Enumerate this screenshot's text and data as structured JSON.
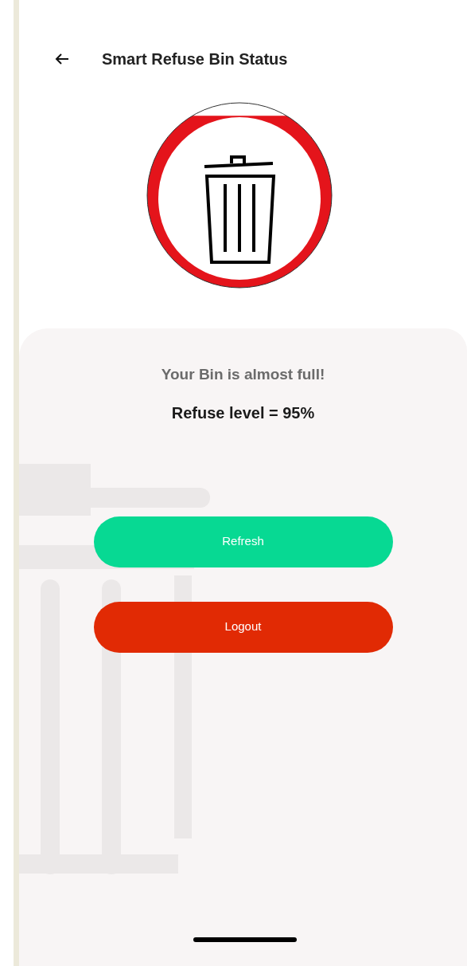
{
  "header": {
    "title": "Smart Refuse Bin Status"
  },
  "gauge": {
    "level": 0.93
  },
  "status": {
    "message": "Your Bin is almost full!",
    "reading": "Refuse level = 95%"
  },
  "buttons": [
    {
      "label": "Refresh",
      "kind": "refresh"
    },
    {
      "label": "Logout",
      "kind": "logout"
    }
  ]
}
